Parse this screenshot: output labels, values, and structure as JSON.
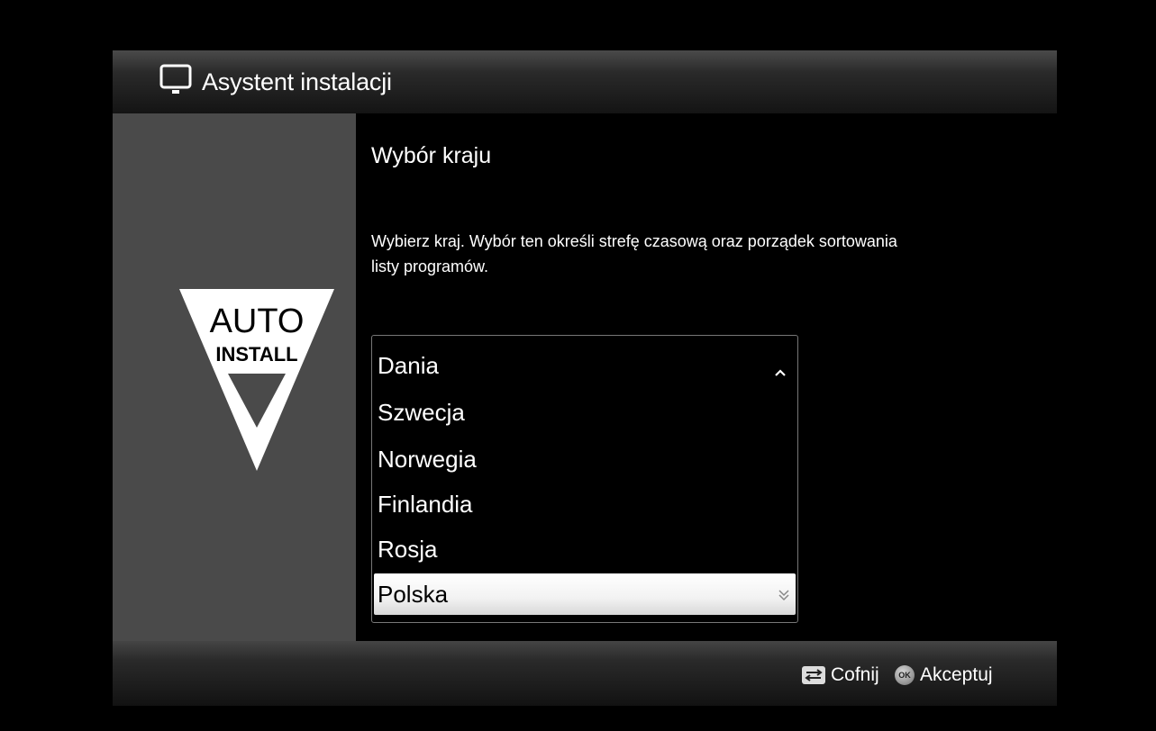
{
  "header": {
    "title": "Asystent instalacji",
    "icon": "tv-icon"
  },
  "side_panel": {
    "logo": {
      "line1": "AUTO",
      "line2": "INSTALL"
    }
  },
  "main": {
    "section_title": "Wybór kraju",
    "description_line1": "Wybierz kraj. Wybór ten określi strefę czasową oraz porządek sortowania",
    "description_line2": "listy programów.",
    "countries": [
      {
        "label": "Dania"
      },
      {
        "label": "Szwecja"
      },
      {
        "label": "Norwegia"
      },
      {
        "label": "Finlandia"
      },
      {
        "label": "Rosja"
      },
      {
        "label": "Polska"
      }
    ],
    "selected_index": 5
  },
  "footer": {
    "back_label": "Cofnij",
    "ok_icon_text": "OK",
    "accept_label": "Akceptuj"
  }
}
